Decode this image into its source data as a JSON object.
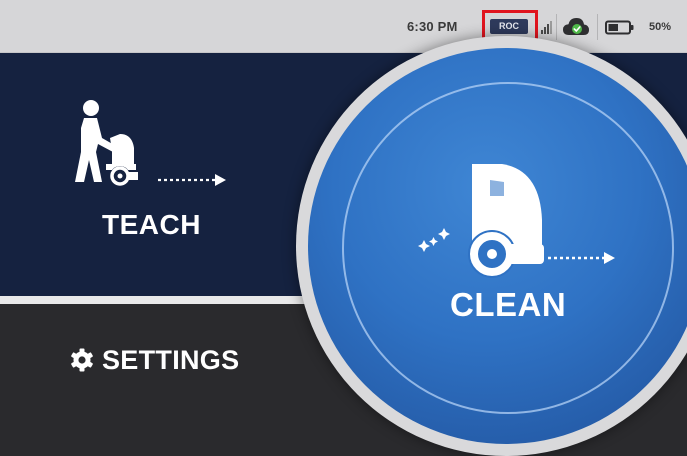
{
  "status_bar": {
    "time": "6:30 PM",
    "roc_badge": "ROC",
    "battery_percent": "50%",
    "battery_level": 0.5,
    "icons": [
      "signal-icon",
      "cloud-check-icon",
      "battery-icon"
    ]
  },
  "teach": {
    "label": "TEACH",
    "icon": "operator-pushing-cleaner-icon"
  },
  "clean": {
    "label": "CLEAN",
    "icon": "cleaning-robot-icon"
  },
  "settings": {
    "label": "SETTINGS",
    "icon": "gear-icon"
  },
  "colors": {
    "status_bar_bg": "#d6d6d8",
    "teach_bg": "#152240",
    "settings_bg": "#2a2a2d",
    "clean_blue": "#2f72c4",
    "highlight_red": "#e0141e"
  }
}
